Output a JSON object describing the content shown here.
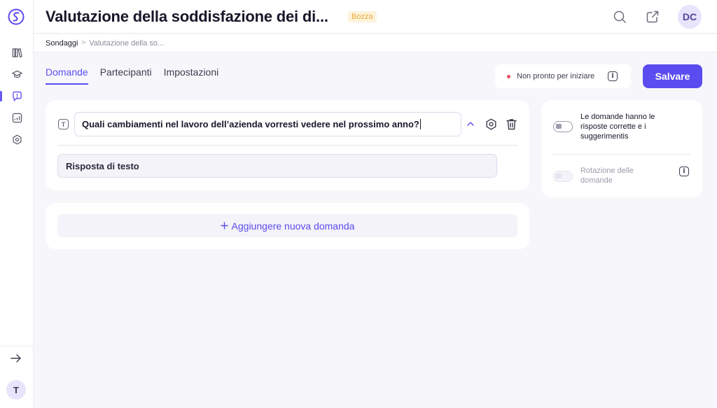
{
  "header": {
    "title": "Valutazione della soddisfazione dei di...",
    "badge": "Bozza",
    "avatar_initials": "DC",
    "icons": [
      "search-icon",
      "external-link-icon"
    ]
  },
  "breadcrumb": {
    "root": "Sondaggi",
    "separator": ">",
    "current": "Valutazione della so..."
  },
  "sidebar": {
    "items": [
      "library-icon",
      "graduation-cap-icon",
      "survey-icon",
      "analytics-icon",
      "settings-hex-icon"
    ],
    "active_index": 2,
    "collapse_icon": "arrow-right-icon",
    "user_initial": "T"
  },
  "tabs": [
    {
      "label": "Domande",
      "active": true
    },
    {
      "label": "Partecipanti",
      "active": false
    },
    {
      "label": "Impostazioni",
      "active": false
    }
  ],
  "status": {
    "text": "Non pronto per iniziare",
    "dot_color": "#ef4b5f"
  },
  "save_label": "Salvare",
  "question": {
    "type_icon": "T",
    "text": "Quali cambiamenti nel lavoro dell’azienda vorresti vedere nel prossimo anno?",
    "answer_type": "Risposta di testo"
  },
  "add_question_label": "Aggiungere nuova domanda",
  "settings_options": [
    {
      "label": "Le domande hanno le risposte corrette e i suggerimentis",
      "enabled": false,
      "disabled": false
    },
    {
      "label": "Rotazione delle domande",
      "enabled": false,
      "disabled": true
    }
  ],
  "colors": {
    "accent": "#5b4cf0",
    "badge_bg": "#fdf3dc",
    "badge_text": "#e9a934"
  }
}
